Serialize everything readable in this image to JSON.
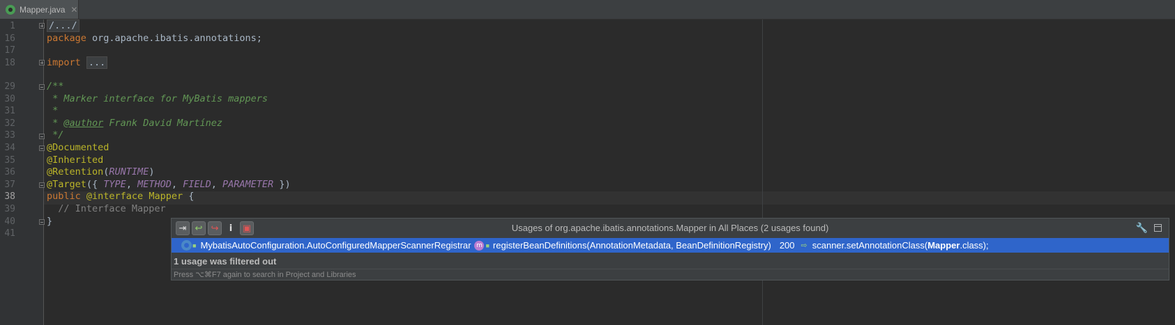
{
  "tab": {
    "filename": "Mapper.java",
    "icon": "interface-icon",
    "close": "✕"
  },
  "line_numbers": [
    "1",
    "16",
    "17",
    "18",
    "29",
    "30",
    "31",
    "32",
    "33",
    "34",
    "35",
    "36",
    "37",
    "38",
    "39",
    "40",
    "41"
  ],
  "current_line": "38",
  "code": {
    "l1": "/.../",
    "pkg_kw": "package",
    "pkg_name": " org.apache.ibatis.annotations;",
    "import_kw": "import",
    "import_fold": "...",
    "doc_open": "/**",
    "doc_line1": " * Marker interface for MyBatis mappers",
    "doc_line2": " *",
    "doc_line3_prefix": " * ",
    "doc_tag": "@author",
    "doc_line3_rest": " Frank David Martínez",
    "doc_close": " */",
    "ann1": "@Documented",
    "ann2": "@Inherited",
    "ann3_name": "@Retention",
    "ann3_open": "(",
    "ann3_const": "RUNTIME",
    "ann3_close": ")",
    "ann4_name": "@Target",
    "ann4_open": "({ ",
    "ann4_c1": "TYPE",
    "ann4_c2": "METHOD",
    "ann4_c3": "FIELD",
    "ann4_c4": "PARAMETER",
    "ann4_close": " })",
    "sep": ", ",
    "decl_kw": "public",
    "decl_ann": " @interface",
    "decl_name": " Mapper",
    "decl_brace": " {",
    "body_comment": "  // Interface Mapper",
    "close_brace": "}"
  },
  "popup": {
    "title": "Usages of org.apache.ibatis.annotations.Mapper in All Places (2 usages found)",
    "buttons": [
      "merge-icon",
      "previous-icon",
      "next-icon",
      "info-icon",
      "filter-icon"
    ],
    "info_label": "i",
    "result": {
      "class_name": "MybatisAutoConfiguration.AutoConfiguredMapperScannerRegistrar",
      "method_badge": "m",
      "method": "registerBeanDefinitions(AnnotationMetadata, BeanDefinitionRegistry)",
      "line": "200",
      "code_prefix": "scanner.setAnnotationClass(",
      "code_match": "Mapper",
      "code_suffix": ".class);"
    },
    "filtered_note": "1 usage was filtered out",
    "hint": "Press ⌥⌘F7 again to search in Project and Libraries"
  },
  "colors": {
    "background": "#2b2b2b",
    "keyword": "#cc7832",
    "annotation": "#bbb529",
    "doc_comment": "#629755",
    "constant": "#9876aa",
    "selection": "#2f65ca"
  }
}
